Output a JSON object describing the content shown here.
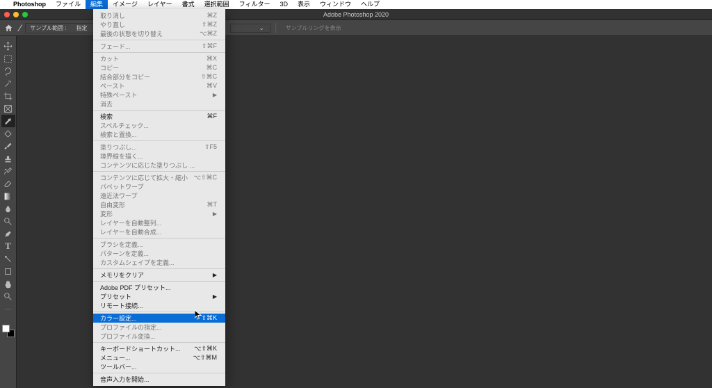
{
  "menubar": {
    "app": "Photoshop",
    "items": [
      "ファイル",
      "編集",
      "イメージ",
      "レイヤー",
      "書式",
      "選択範囲",
      "フィルター",
      "3D",
      "表示",
      "ウィンドウ",
      "ヘルプ"
    ],
    "active_index": 1
  },
  "window": {
    "title": "Adobe Photoshop 2020"
  },
  "options_bar": {
    "label_prefix": "サンプル範囲 :",
    "label_truncated": "指定",
    "right_text": "サンプルリングを表示"
  },
  "edit_menu": {
    "groups": [
      [
        {
          "label": "取り消し",
          "sc": "⌘Z",
          "enabled": false
        },
        {
          "label": "やり直し",
          "sc": "⇧⌘Z",
          "enabled": false
        },
        {
          "label": "最後の状態を切り替え",
          "sc": "⌥⌘Z",
          "enabled": false
        }
      ],
      [
        {
          "label": "フェード...",
          "sc": "⇧⌘F",
          "enabled": false
        }
      ],
      [
        {
          "label": "カット",
          "sc": "⌘X",
          "enabled": false
        },
        {
          "label": "コピー",
          "sc": "⌘C",
          "enabled": false
        },
        {
          "label": "結合部分をコピー",
          "sc": "⇧⌘C",
          "enabled": false
        },
        {
          "label": "ペースト",
          "sc": "⌘V",
          "enabled": false
        },
        {
          "label": "特殊ペースト",
          "sc": "▶",
          "enabled": false,
          "submenu": true
        },
        {
          "label": "消去",
          "sc": "",
          "enabled": false
        }
      ],
      [
        {
          "label": "検索",
          "sc": "⌘F",
          "enabled": true
        },
        {
          "label": "スペルチェック...",
          "sc": "",
          "enabled": false
        },
        {
          "label": "検索と置換...",
          "sc": "",
          "enabled": false
        }
      ],
      [
        {
          "label": "塗りつぶし...",
          "sc": "⇧F5",
          "enabled": false
        },
        {
          "label": "境界線を描く...",
          "sc": "",
          "enabled": false
        },
        {
          "label": "コンテンツに応じた塗りつぶし ...",
          "sc": "",
          "enabled": false
        }
      ],
      [
        {
          "label": "コンテンツに応じて拡大・縮小",
          "sc": "⌥⇧⌘C",
          "enabled": false
        },
        {
          "label": "パペットワープ",
          "sc": "",
          "enabled": false
        },
        {
          "label": "遠近法ワープ",
          "sc": "",
          "enabled": false
        },
        {
          "label": "自由変形",
          "sc": "⌘T",
          "enabled": false
        },
        {
          "label": "変形",
          "sc": "▶",
          "enabled": false,
          "submenu": true
        },
        {
          "label": "レイヤーを自動整列...",
          "sc": "",
          "enabled": false
        },
        {
          "label": "レイヤーを自動合成...",
          "sc": "",
          "enabled": false
        }
      ],
      [
        {
          "label": "ブラシを定義...",
          "sc": "",
          "enabled": false
        },
        {
          "label": "パターンを定義...",
          "sc": "",
          "enabled": false
        },
        {
          "label": "カスタムシェイプを定義...",
          "sc": "",
          "enabled": false
        }
      ],
      [
        {
          "label": "メモリをクリア",
          "sc": "▶",
          "enabled": true,
          "submenu": true
        }
      ],
      [
        {
          "label": "Adobe PDF プリセット...",
          "sc": "",
          "enabled": true
        },
        {
          "label": "プリセット",
          "sc": "▶",
          "enabled": true,
          "submenu": true
        },
        {
          "label": "リモート接続...",
          "sc": "",
          "enabled": true
        }
      ],
      [
        {
          "label": "カラー設定...",
          "sc": "⇧⌘K",
          "enabled": true,
          "highlighted": true
        },
        {
          "label": "プロファイルの指定...",
          "sc": "",
          "enabled": false
        },
        {
          "label": "プロファイル変換...",
          "sc": "",
          "enabled": false
        }
      ],
      [
        {
          "label": "キーボードショートカット...",
          "sc": "⌥⇧⌘K",
          "enabled": true
        },
        {
          "label": "メニュー...",
          "sc": "⌥⇧⌘M",
          "enabled": true
        },
        {
          "label": "ツールバー...",
          "sc": "",
          "enabled": true
        }
      ],
      [
        {
          "label": "音声入力を開始...",
          "sc": "",
          "enabled": true
        }
      ]
    ]
  }
}
